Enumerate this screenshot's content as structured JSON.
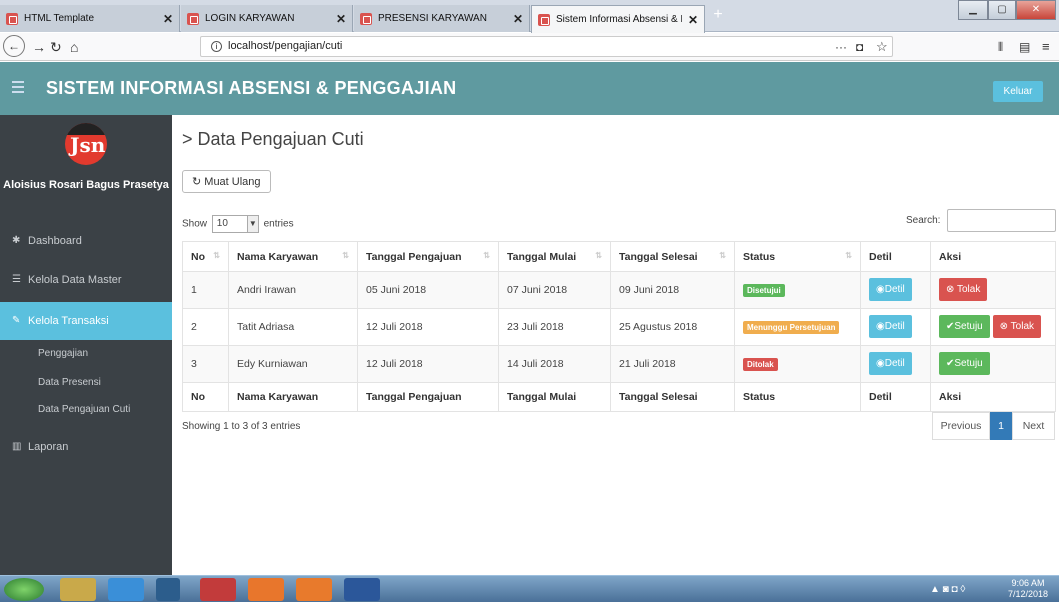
{
  "browser": {
    "tabs": [
      {
        "label": "HTML Template",
        "close": "✕"
      },
      {
        "label": "LOGIN KARYAWAN",
        "close": "✕"
      },
      {
        "label": "PRESENSI KARYAWAN",
        "close": "✕"
      },
      {
        "label": "Sistem Informasi Absensi & Pen",
        "close": "✕"
      }
    ],
    "new_tab": "+",
    "url": "localhost/pengajian/cuti",
    "window_controls": [
      "▁",
      "▢",
      "✕"
    ]
  },
  "header": {
    "title": "SISTEM INFORMASI ABSENSI & PENGGAJIAN",
    "logout_label": "Keluar"
  },
  "sidebar": {
    "logo_text": "Jsn",
    "username": "Aloisius Rosari Bagus Prasetya",
    "items": [
      {
        "label": "Dashboard",
        "icon": "dashboard-icon"
      },
      {
        "label": "Kelola Data Master",
        "icon": "list-icon"
      },
      {
        "label": "Kelola Transaksi",
        "icon": "edit-icon"
      },
      {
        "label": "Laporan",
        "icon": "bar-chart-icon"
      }
    ],
    "subitems": [
      "Penggajian",
      "Data Presensi",
      "Data Pengajuan Cuti"
    ]
  },
  "content": {
    "page_title": "> Data Pengajuan Cuti",
    "reload_label": "Muat Ulang",
    "show_label": "Show",
    "entries_value": "10",
    "entries_label": "entries",
    "search_label": "Search:",
    "columns": [
      "No",
      "Nama Karyawan",
      "Tanggal Pengajuan",
      "Tanggal Mulai",
      "Tanggal Selesai",
      "Status",
      "Detil",
      "Aksi"
    ],
    "rows": [
      {
        "no": "1",
        "nama": "Andri Irawan",
        "pengajuan": "05 Juni 2018",
        "mulai": "07 Juni 2018",
        "selesai": "09 Juni 2018",
        "status": "Disetujui",
        "detil": "Detil",
        "aksi": [
          "Tolak"
        ]
      },
      {
        "no": "2",
        "nama": "Tatit Adriasa",
        "pengajuan": "12 Juli 2018",
        "mulai": "23 Juli 2018",
        "selesai": "25 Agustus 2018",
        "status": "Menunggu Persetujuan",
        "detil": "Detil",
        "aksi": [
          "Setuju",
          "Tolak"
        ]
      },
      {
        "no": "3",
        "nama": "Edy Kurniawan",
        "pengajuan": "12 Juli 2018",
        "mulai": "14 Juli 2018",
        "selesai": "21 Juli 2018",
        "status": "Ditolak",
        "detil": "Detil",
        "aksi": [
          "Setuju"
        ]
      }
    ],
    "info": "Showing 1 to 3 of 3 entries",
    "pagination": {
      "previous": "Previous",
      "current": "1",
      "next": "Next"
    }
  },
  "taskbar": {
    "time": "9:06 AM",
    "date": "7/12/2018"
  },
  "colors": {
    "header": "#5f9aa0",
    "sidebar": "#3b4146",
    "active": "#5bc0de",
    "approved": "#5cb85c",
    "pending": "#f0ad4e",
    "rejected": "#d9534f"
  }
}
